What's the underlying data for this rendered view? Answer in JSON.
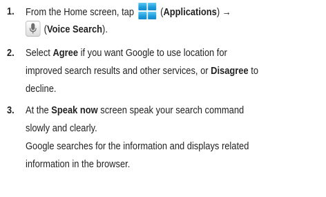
{
  "steps": [
    {
      "number": "1.",
      "lines": {
        "l1_a": "From the Home screen, tap",
        "l1_b": "(",
        "l1_bold": "Applications",
        "l1_c": ") →",
        "l2_a": "(",
        "l2_bold": "Voice Search",
        "l2_b": ")."
      },
      "icons": [
        "applications-grid-icon",
        "microphone-icon"
      ]
    },
    {
      "number": "2.",
      "lines": {
        "l1_a": "Select ",
        "l1_bold": "Agree",
        "l1_b": " if you want Google to use location for",
        "l2_a": "improved search results and other services, or ",
        "l2_bold": "Disagree",
        "l2_b": " to",
        "l3": "decline."
      }
    },
    {
      "number": "3.",
      "lines": {
        "l1_a": "At the ",
        "l1_bold": "Speak now",
        "l1_b": " screen speak your search command",
        "l2": "slowly and clearly.",
        "l3": "Google searches for the information and displays related",
        "l4": "information in the browser."
      }
    }
  ],
  "colors": {
    "text": "#222222",
    "apps_icon_blue": "#1e9fde",
    "mic_icon_grey": "#6e6e6e"
  }
}
